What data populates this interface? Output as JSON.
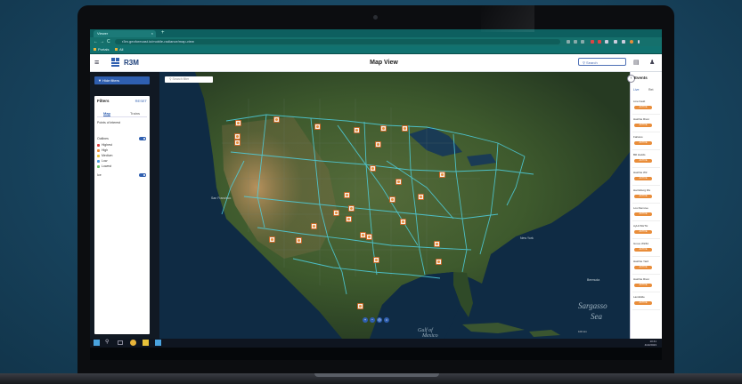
{
  "browser": {
    "tab_title": "Viewer",
    "tab_close": "×",
    "new_tab": "+",
    "back": "←",
    "forward": "→",
    "reload": "C",
    "url": "r3m.geoforecast.io/mobile-radiance/map-view",
    "bookmarks": [
      "Portals",
      "All"
    ]
  },
  "app": {
    "menu_icon": "≡",
    "brand": "R3M",
    "page_title": "Map View",
    "search_placeholder": "Search",
    "header_icons": [
      "clipboard-icon",
      "user-icon"
    ]
  },
  "left_panel": {
    "hide_filters_label": "Hide filters",
    "filters_title": "Filters",
    "reset_label": "RESET",
    "tabs": [
      "Map",
      "Trains"
    ],
    "points_of_interest": "Points of interest",
    "outlines_label": "Outlines",
    "legend": [
      {
        "label": "Highest",
        "color": "#d94040"
      },
      {
        "label": "High",
        "color": "#e98d3a"
      },
      {
        "label": "Medium",
        "color": "#e8c23a"
      },
      {
        "label": "Low",
        "color": "#4a9be0"
      },
      {
        "label": "Lowest",
        "color": "#6ac46a"
      }
    ],
    "bottom_label": "Ice"
  },
  "map": {
    "search_placeholder": "Search filter",
    "labels": [
      {
        "text": "New York"
      },
      {
        "text": "San Francisco"
      },
      {
        "text": "Bermuda"
      }
    ],
    "oceans": [
      {
        "text": "Gulf of"
      },
      {
        "text": "Mexico"
      },
      {
        "text": "Sargasso"
      },
      {
        "text": "Sea"
      }
    ],
    "zoom_controls": [
      "+",
      "−",
      "◎",
      "⌂"
    ],
    "scale_text": "100 km"
  },
  "events_panel": {
    "title": "Events",
    "collapse": "‹",
    "tabs": [
      "Live",
      "Ret"
    ],
    "cards": [
      {
        "title": "Line Fault",
        "badge": "ACTIVE"
      },
      {
        "title": "Hatchie River",
        "badge": "ACTIVE"
      },
      {
        "title": "Failures",
        "badge": "ACTIVE"
      },
      {
        "title": "Bill Hodds",
        "badge": "ACTIVE"
      },
      {
        "title": "Hatchie Wtr",
        "badge": "ACTIVE"
      },
      {
        "title": "Harrisburg Div",
        "badge": "ACTIVE"
      },
      {
        "title": "Los Remove",
        "badge": "ACTIVE"
      },
      {
        "title": "AyHt WHTH",
        "badge": "ACTIVE"
      },
      {
        "title": "Grove Wtrfld",
        "badge": "ACTIVE"
      },
      {
        "title": "Hatchie Yard",
        "badge": "ACTIVE"
      },
      {
        "title": "Hatchie River",
        "badge": "ACTIVE"
      },
      {
        "title": "Landslide",
        "badge": "ACTIVE"
      }
    ]
  },
  "taskbar": {
    "clock_time": "10:41",
    "clock_date": "4/22/2023"
  }
}
